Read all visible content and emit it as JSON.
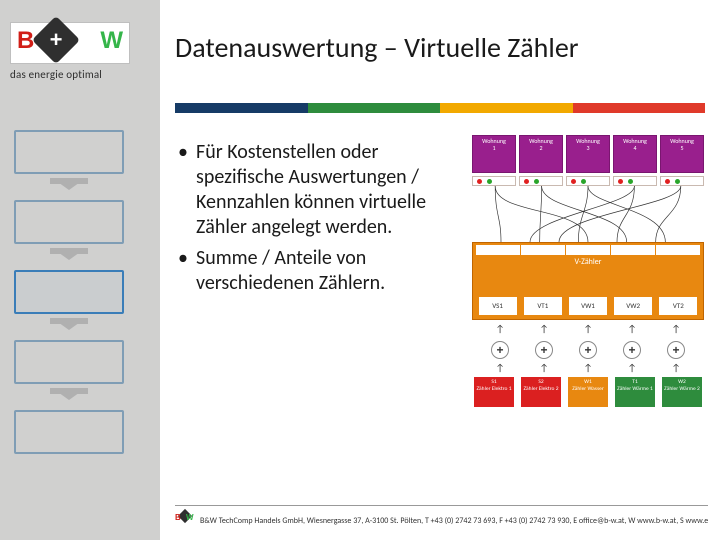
{
  "title": "Datenauswertung – Virtuelle Zähler",
  "logo": {
    "b": "B",
    "plus": "+",
    "w": "W",
    "sub": "das energie optimal"
  },
  "bullets": [
    "Für Kostenstellen oder spezifische Auswertungen / Kennzahlen können virtuelle Zähler angelegt werden.",
    "Summe / Anteile von verschiedenen Zählern."
  ],
  "diagram": {
    "wohnungen": [
      {
        "label": "Wohnung",
        "num": "1"
      },
      {
        "label": "Wohnung",
        "num": "2"
      },
      {
        "label": "Wohnung",
        "num": "3"
      },
      {
        "label": "Wohnung",
        "num": "4"
      },
      {
        "label": "Wohnung",
        "num": "5"
      }
    ],
    "mid_label": "V-Zähler",
    "vz": [
      "VS1",
      "VT1",
      "VW1",
      "VW2",
      "VT2"
    ],
    "plus": [
      "+",
      "+",
      "+",
      "+",
      "+"
    ],
    "zr": [
      {
        "t1": "S1",
        "t2": "Zähler Elektro 1",
        "cls": "r"
      },
      {
        "t1": "S2",
        "t2": "Zähler Elektro 2",
        "cls": "r"
      },
      {
        "t1": "W1",
        "t2": "Zähler Wasser",
        "cls": "o"
      },
      {
        "t1": "T1",
        "t2": "Zähler Wärme 1",
        "cls": "g"
      },
      {
        "t1": "W2",
        "t2": "Zähler Wärme 2",
        "cls": "g"
      }
    ]
  },
  "footer": "B&W TechComp Handels GmbH, Wiesnergasse 37, A-3100 St. Pölten, T +43 (0) 2742 73 693, F +43 (0) 2742 73 930, E office@b-w.at, W www.b-w.at, S www.energy-shop.at"
}
